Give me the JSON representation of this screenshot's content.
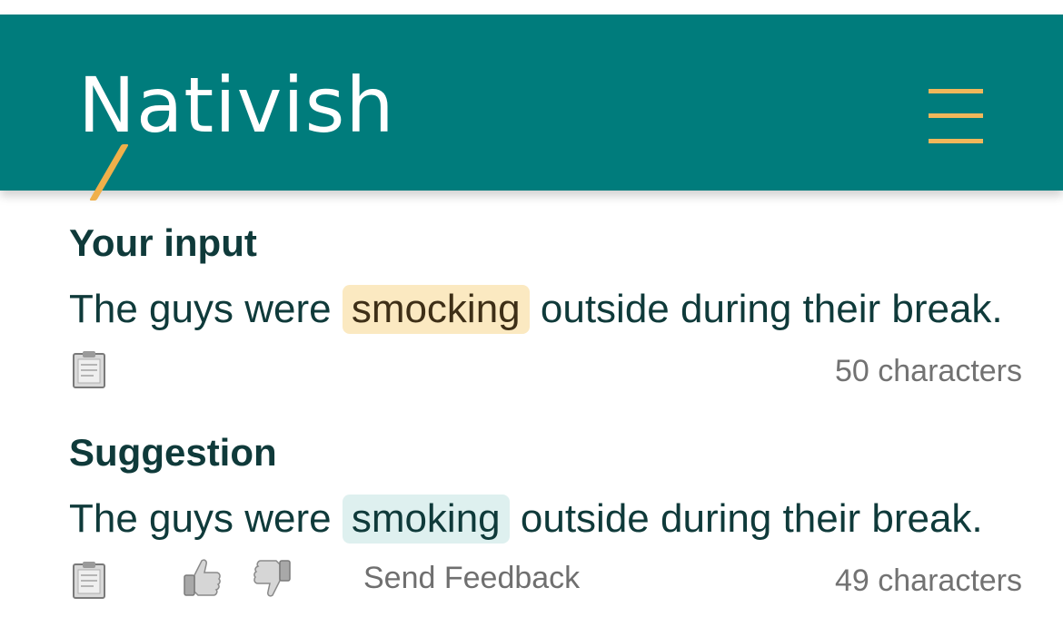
{
  "header": {
    "logo": "Nativish",
    "brand_color": "#007c7c",
    "accent_color": "#f0b75a",
    "menu_icon": "hamburger-menu-icon"
  },
  "input": {
    "title": "Your input",
    "before": "The guys were",
    "highlight": "smocking",
    "after": "outside during their break.",
    "copy_icon": "clipboard-icon",
    "count": "50 characters"
  },
  "suggestion": {
    "title": "Suggestion",
    "before": "The guys were",
    "highlight": "smoking",
    "after": "outside during their break.",
    "copy_icon": "clipboard-icon",
    "thumbs_up_icon": "thumbs-up-icon",
    "thumbs_down_icon": "thumbs-down-icon",
    "feedback_label": "Send Feedback",
    "count": "49 characters"
  }
}
